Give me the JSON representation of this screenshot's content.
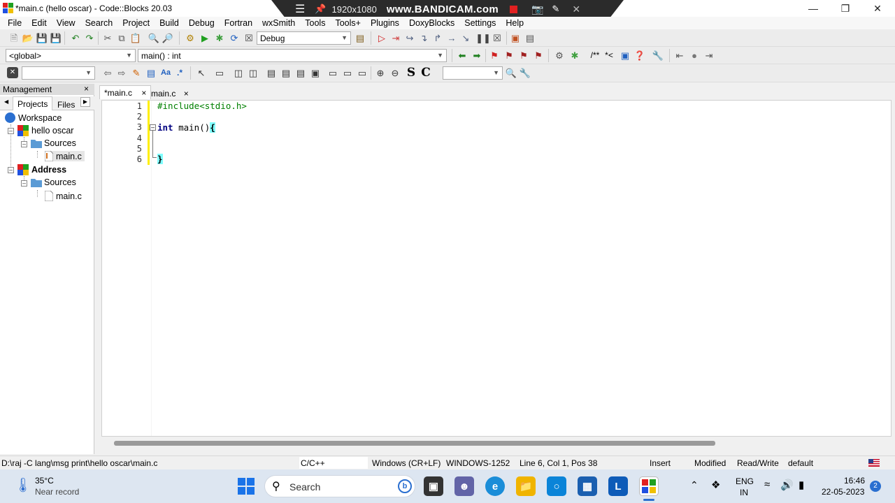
{
  "window": {
    "title": "*main.c (hello oscar) - Code::Blocks 20.03"
  },
  "recorder": {
    "resolution": "1920x1080",
    "brand": "www.BANDICAM.com"
  },
  "menu": [
    "File",
    "Edit",
    "View",
    "Search",
    "Project",
    "Build",
    "Debug",
    "Fortran",
    "wxSmith",
    "Tools",
    "Tools+",
    "Plugins",
    "DoxyBlocks",
    "Settings",
    "Help"
  ],
  "toolbar": {
    "build_target": "Debug",
    "scope": "<global>",
    "function": "main() : int",
    "doxy_comment_block": "/**",
    "doxy_comment_line": "*<"
  },
  "management": {
    "title": "Management",
    "close": "×",
    "tabs": [
      "Projects",
      "Files"
    ],
    "tree": {
      "workspace": "Workspace",
      "project1": "hello oscar",
      "sources1": "Sources",
      "file1": "main.c",
      "project2": "Address",
      "sources2": "Sources",
      "file2": "main.c"
    }
  },
  "editor": {
    "tabs": [
      {
        "label": "*main.c",
        "close": "×"
      },
      {
        "label": "main.c",
        "close": "×"
      }
    ],
    "line_numbers": [
      "1",
      "2",
      "3",
      "4",
      "5",
      "6"
    ],
    "code": {
      "line1": "#include<stdio.h>",
      "line3_kw": "int",
      "line3_rest": " main()",
      "line3_brace": "{",
      "line6_brace": "}"
    }
  },
  "status": {
    "path": "D:\\raj -C lang\\msg print\\hello oscar\\main.c",
    "language": "C/C++",
    "eol": "Windows (CR+LF)",
    "encoding": "WINDOWS-1252",
    "position": "Line 6, Col 1, Pos 38",
    "mode": "Insert",
    "modified": "Modified",
    "access": "Read/Write",
    "default": "default"
  },
  "taskbar": {
    "weather_temp": "35°C",
    "weather_desc": "Near record",
    "search_placeholder": "Search",
    "lang_line1": "ENG",
    "lang_line2": "IN",
    "time": "16:46",
    "date": "22-05-2023",
    "notification_count": "2"
  },
  "colors": {
    "keyword": "#000080",
    "preprocessor": "#008000",
    "brace_highlight": "#80ffff",
    "changebar": "#ffef00"
  }
}
